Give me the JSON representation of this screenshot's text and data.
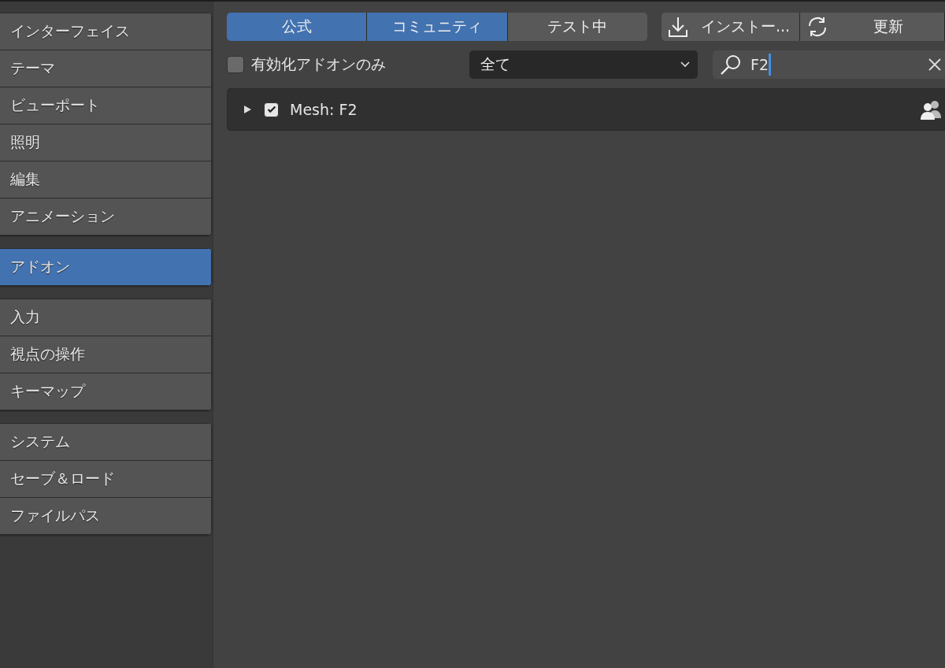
{
  "sidebar": {
    "groups": [
      {
        "items": [
          {
            "label": "インターフェイス",
            "selected": false
          },
          {
            "label": "テーマ",
            "selected": false
          },
          {
            "label": "ビューポート",
            "selected": false
          },
          {
            "label": "照明",
            "selected": false
          },
          {
            "label": "編集",
            "selected": false
          },
          {
            "label": "アニメーション",
            "selected": false
          }
        ]
      },
      {
        "items": [
          {
            "label": "アドオン",
            "selected": true
          }
        ]
      },
      {
        "items": [
          {
            "label": "入力",
            "selected": false
          },
          {
            "label": "視点の操作",
            "selected": false
          },
          {
            "label": "キーマップ",
            "selected": false
          }
        ]
      },
      {
        "items": [
          {
            "label": "システム",
            "selected": false
          },
          {
            "label": "セーブ＆ロード",
            "selected": false
          },
          {
            "label": "ファイルパス",
            "selected": false
          }
        ]
      }
    ]
  },
  "support_tabs": [
    {
      "label": "公式",
      "selected": true
    },
    {
      "label": "コミュニティ",
      "selected": true
    },
    {
      "label": "テスト中",
      "selected": false
    }
  ],
  "actions": [
    {
      "label": "インストー...",
      "kind": "install"
    },
    {
      "label": "更新",
      "kind": "refresh"
    }
  ],
  "enabled_only": {
    "label": "有効化アドオンのみ",
    "checked": false
  },
  "category_dropdown": {
    "value": "全て"
  },
  "search": {
    "value": "F2"
  },
  "addons": [
    {
      "name": "Mesh: F2",
      "expanded": false,
      "enabled": true
    }
  ]
}
